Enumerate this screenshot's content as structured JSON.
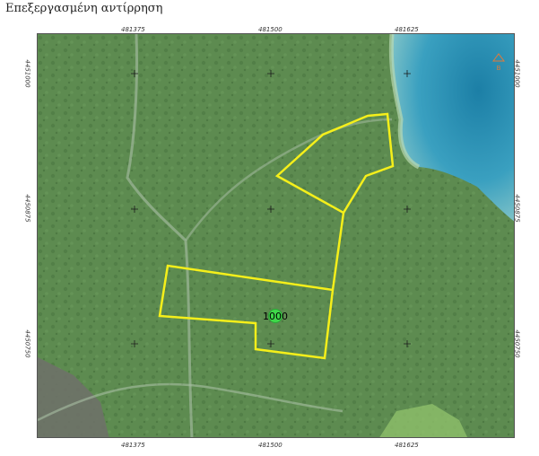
{
  "title": "Επεξεργασμένη αντίρρηση",
  "x_ticks_top": [
    "481375",
    "481500",
    "481625"
  ],
  "x_ticks_bottom": [
    "481375",
    "481500",
    "481625"
  ],
  "y_ticks_left": [
    "4451000",
    "4450875",
    "4450750"
  ],
  "y_ticks_right": [
    "4451000",
    "4450875",
    "4450750"
  ],
  "marker": {
    "label": "1000",
    "color": "#3fd94a"
  },
  "colors": {
    "boundary": "#f5ef1a",
    "vegetation": "#5d8a4f",
    "sea": "#2f8fb0"
  },
  "corner_mark": "B"
}
